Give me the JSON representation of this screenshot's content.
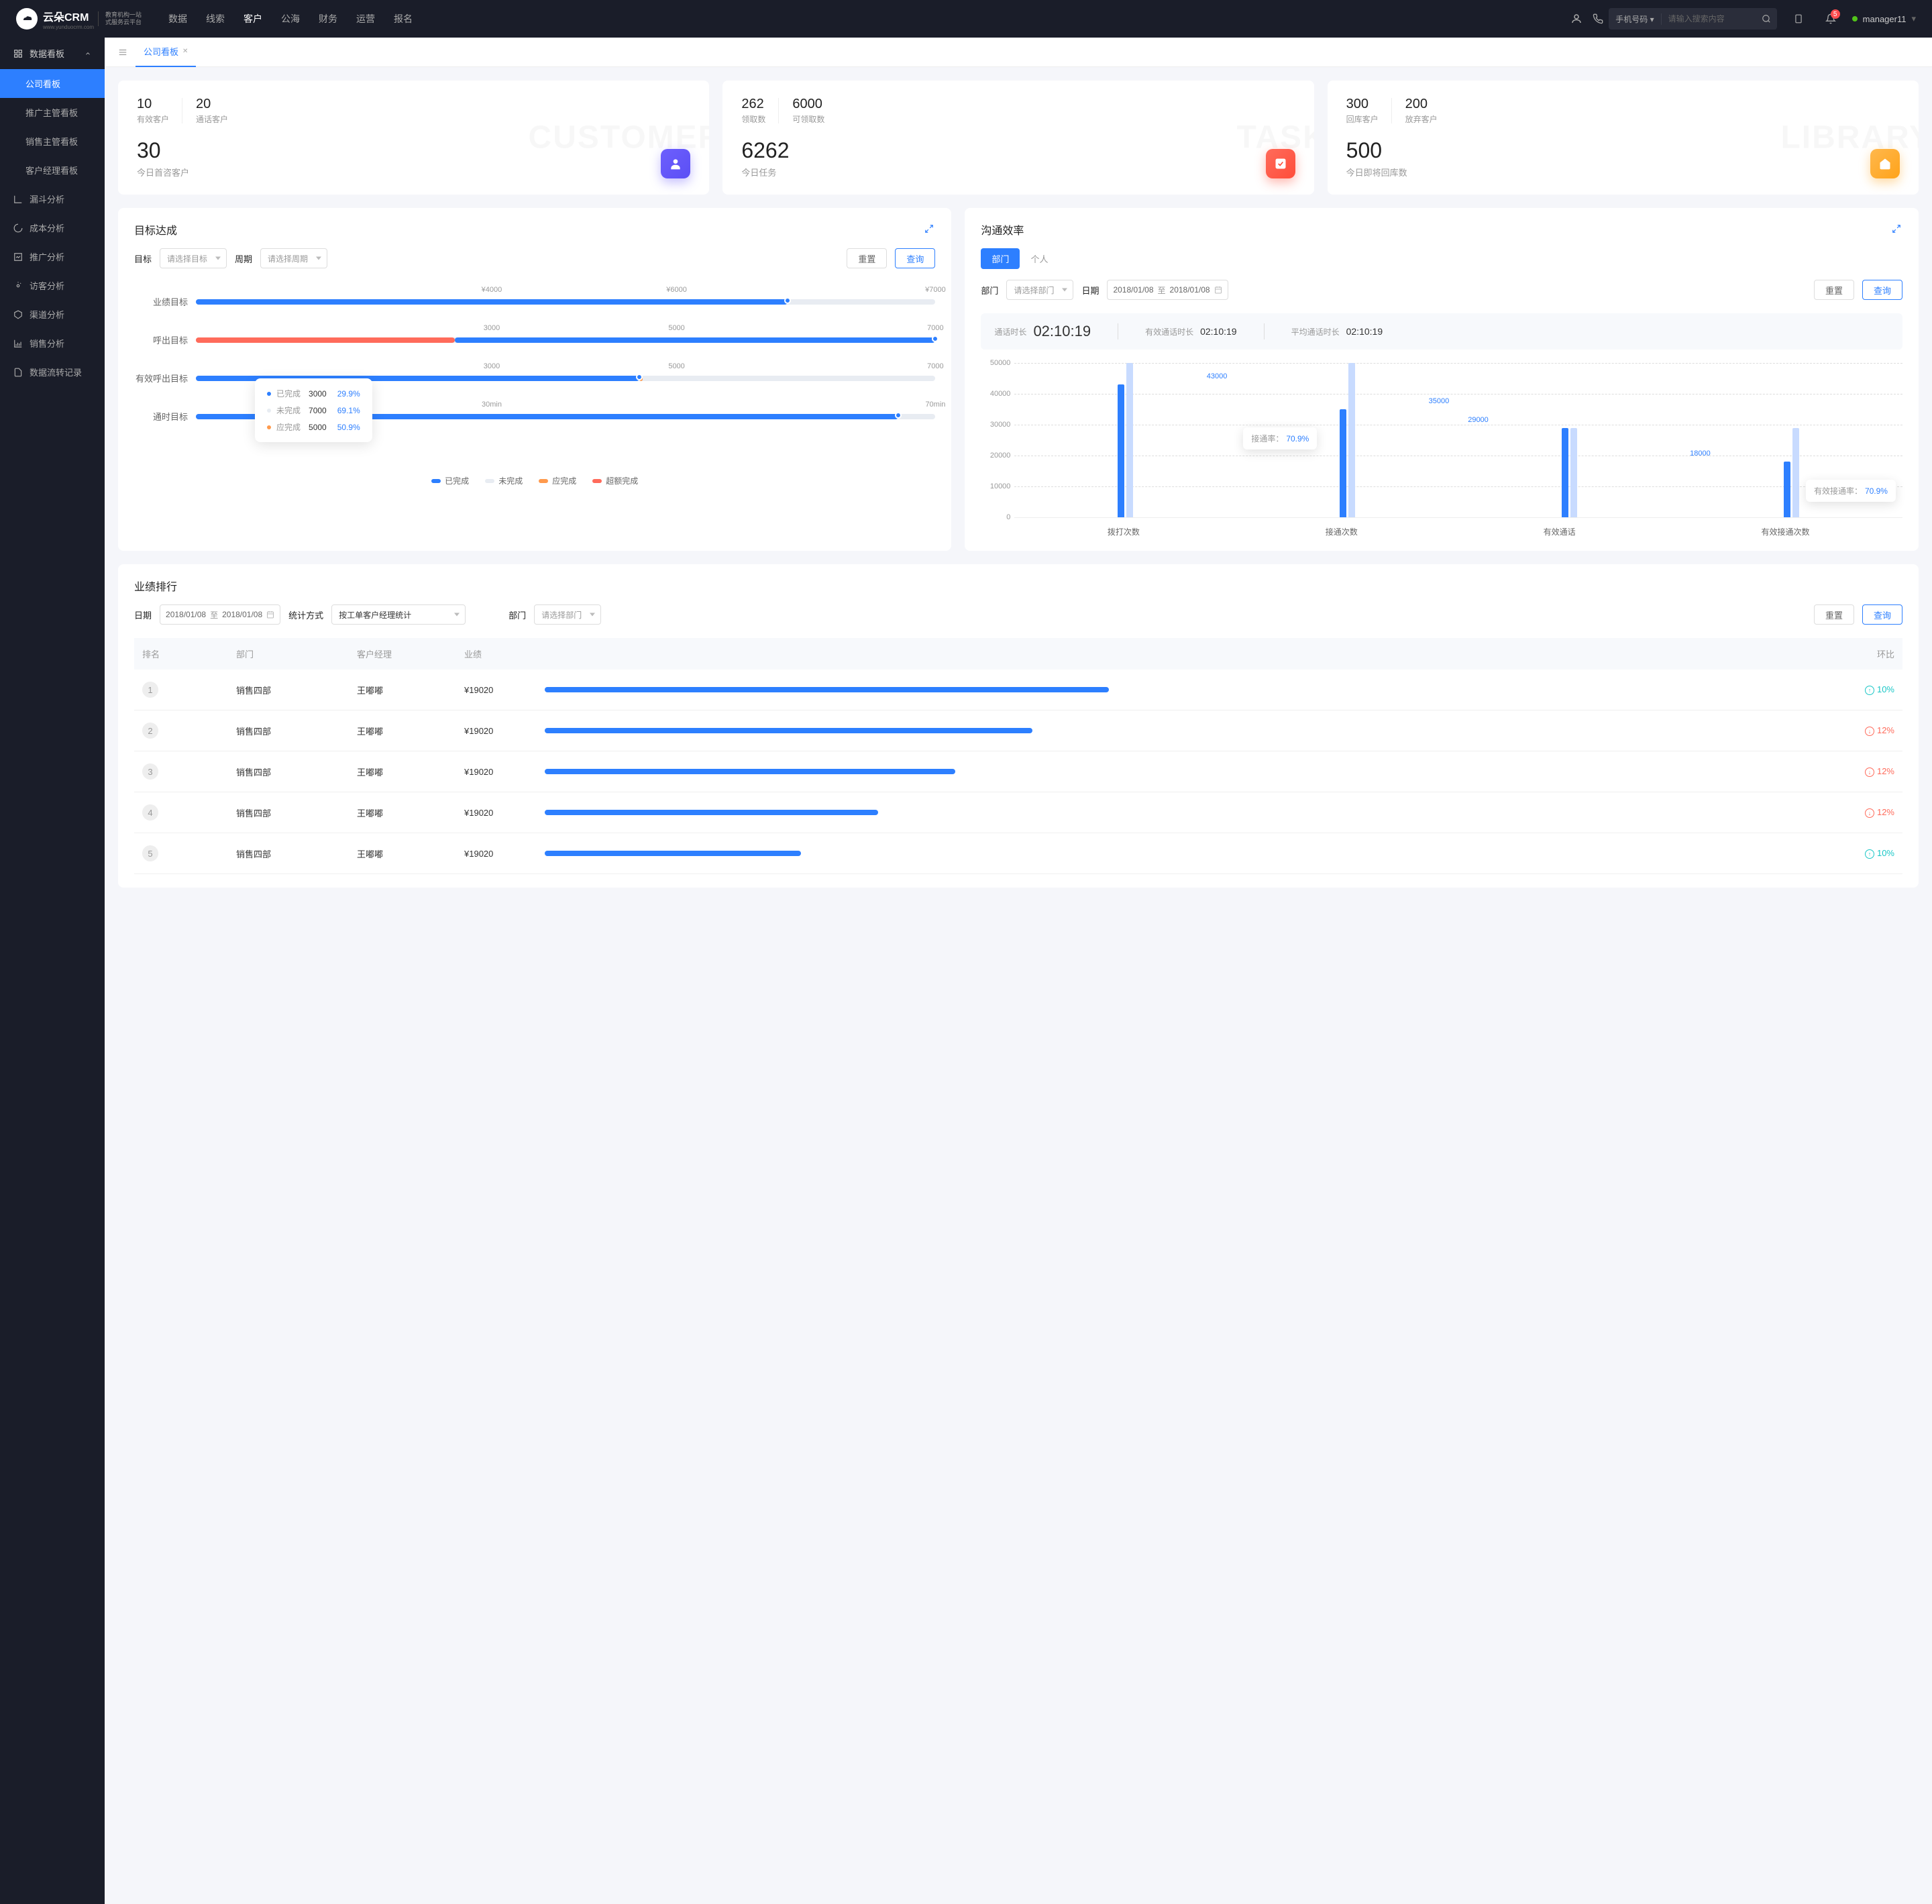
{
  "brand": {
    "name": "云朵CRM",
    "subtitle1": "教育机构一站",
    "subtitle2": "式服务云平台",
    "site": "www.yunduocrm.com"
  },
  "topNav": [
    "数据",
    "线索",
    "客户",
    "公海",
    "财务",
    "运营",
    "报名"
  ],
  "topNavActive": "客户",
  "search": {
    "type": "手机号码",
    "placeholder": "请输入搜索内容"
  },
  "notifBadge": "5",
  "user": "manager11",
  "sidebar": {
    "group": "数据看板",
    "items": [
      "公司看板",
      "推广主管看板",
      "销售主管看板",
      "客户经理看板"
    ],
    "activeItem": "公司看板",
    "singles": [
      "漏斗分析",
      "成本分析",
      "推广分析",
      "访客分析",
      "渠道分析",
      "销售分析",
      "数据流转记录"
    ]
  },
  "tabs": [
    {
      "label": "公司看板"
    }
  ],
  "stats": [
    {
      "bg": "CUSTOMER",
      "top": [
        {
          "num": "10",
          "label": "有效客户"
        },
        {
          "num": "20",
          "label": "通话客户"
        }
      ],
      "big": {
        "num": "30",
        "label": "今日首咨客户"
      },
      "iconClass": "purple"
    },
    {
      "bg": "TASK",
      "top": [
        {
          "num": "262",
          "label": "领取数"
        },
        {
          "num": "6000",
          "label": "可领取数"
        }
      ],
      "big": {
        "num": "6262",
        "label": "今日任务"
      },
      "iconClass": "red"
    },
    {
      "bg": "LIBRARY",
      "top": [
        {
          "num": "300",
          "label": "回库客户"
        },
        {
          "num": "200",
          "label": "放弃客户"
        }
      ],
      "big": {
        "num": "500",
        "label": "今日即将回库数"
      },
      "iconClass": "orange"
    }
  ],
  "goalPanel": {
    "title": "目标达成",
    "targetLabel": "目标",
    "targetPlaceholder": "请选择目标",
    "periodLabel": "周期",
    "periodPlaceholder": "请选择周期",
    "resetBtn": "重置",
    "queryBtn": "查询",
    "rows": [
      {
        "label": "业绩目标",
        "ticks": [
          "¥4000",
          "¥6000",
          "¥7000"
        ],
        "fillPct": 80
      },
      {
        "label": "呼出目标",
        "ticks": [
          "3000",
          "5000",
          "7000"
        ],
        "fillPct": 100,
        "exceed": 35
      },
      {
        "label": "有效呼出目标",
        "ticks": [
          "3000",
          "5000",
          "7000"
        ],
        "fillPct": 60,
        "orange": true
      },
      {
        "label": "通时目标",
        "ticks": [
          "30min",
          "",
          "70min"
        ],
        "fillPct": 95
      }
    ],
    "legend": [
      {
        "color": "#2d7fff",
        "label": "已完成"
      },
      {
        "color": "#e8ecf2",
        "label": "未完成"
      },
      {
        "color": "#ff9a4d",
        "label": "应完成"
      },
      {
        "color": "#ff6b5b",
        "label": "超额完成"
      }
    ],
    "tooltip": [
      {
        "dot": "#2d7fff",
        "label": "已完成",
        "val": "3000",
        "pct": "29.9%"
      },
      {
        "dot": "#e8ecf2",
        "label": "未完成",
        "val": "7000",
        "pct": "69.1%"
      },
      {
        "dot": "#ff9a4d",
        "label": "应完成",
        "val": "5000",
        "pct": "50.9%"
      }
    ]
  },
  "effPanel": {
    "title": "沟通效率",
    "tabs": [
      "部门",
      "个人"
    ],
    "activeTab": "部门",
    "deptLabel": "部门",
    "deptPlaceholder": "请选择部门",
    "dateLabel": "日期",
    "dateFrom": "2018/01/08",
    "dateSep": "至",
    "dateTo": "2018/01/08",
    "resetBtn": "重置",
    "queryBtn": "查询",
    "duration": [
      {
        "label": "通话时长",
        "value": "02:10:19",
        "big": true
      },
      {
        "label": "有效通话时长",
        "value": "02:10:19"
      },
      {
        "label": "平均通话时长",
        "value": "02:10:19"
      }
    ],
    "tooltips": [
      {
        "label": "接通率：",
        "value": "70.9%",
        "idx": 1
      },
      {
        "label": "有效接通率：",
        "value": "70.9%",
        "idx": 3
      }
    ]
  },
  "ranking": {
    "title": "业绩排行",
    "dateLabel": "日期",
    "dateFrom": "2018/01/08",
    "dateSep": "至",
    "dateTo": "2018/01/08",
    "methodLabel": "统计方式",
    "methodValue": "按工单客户经理统计",
    "deptLabel": "部门",
    "deptPlaceholder": "请选择部门",
    "resetBtn": "重置",
    "queryBtn": "查询",
    "headers": [
      "排名",
      "部门",
      "客户经理",
      "业绩",
      "",
      "环比"
    ],
    "rows": [
      {
        "rank": "1",
        "dept": "销售四部",
        "mgr": "王嘟嘟",
        "perf": "¥19020",
        "bar": 44,
        "trend": "up",
        "trendVal": "10%"
      },
      {
        "rank": "2",
        "dept": "销售四部",
        "mgr": "王嘟嘟",
        "perf": "¥19020",
        "bar": 38,
        "trend": "down",
        "trendVal": "12%"
      },
      {
        "rank": "3",
        "dept": "销售四部",
        "mgr": "王嘟嘟",
        "perf": "¥19020",
        "bar": 32,
        "trend": "down",
        "trendVal": "12%"
      },
      {
        "rank": "4",
        "dept": "销售四部",
        "mgr": "王嘟嘟",
        "perf": "¥19020",
        "bar": 26,
        "trend": "down",
        "trendVal": "12%"
      },
      {
        "rank": "5",
        "dept": "销售四部",
        "mgr": "王嘟嘟",
        "perf": "¥19020",
        "bar": 20,
        "trend": "up",
        "trendVal": "10%"
      }
    ]
  },
  "chart_data": {
    "type": "bar",
    "categories": [
      "拨打次数",
      "接通次数",
      "有效通话",
      "有效接通次数"
    ],
    "series": [
      {
        "name": "light",
        "values": [
          50000,
          50000,
          29000,
          29000
        ]
      },
      {
        "name": "blue",
        "values": [
          43000,
          35000,
          29000,
          18000
        ]
      }
    ],
    "ylim": [
      0,
      50000
    ],
    "yticks": [
      0,
      10000,
      20000,
      30000,
      40000,
      50000
    ],
    "labels": [
      {
        "idx": 0,
        "text": "43000"
      },
      {
        "idx": 1,
        "text": "35000"
      },
      {
        "idx": 2,
        "text": "29000"
      },
      {
        "idx": 3,
        "text": "18000"
      }
    ]
  }
}
